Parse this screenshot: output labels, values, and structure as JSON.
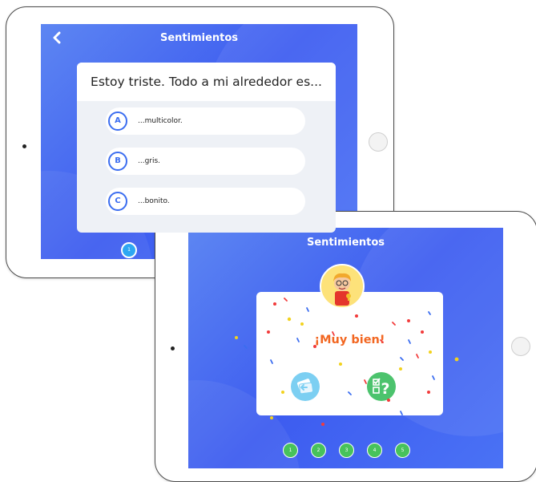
{
  "back_tablet": {
    "title": "Sentimientos",
    "back_icon": "chevron-left-icon",
    "question": "Estoy triste. Todo a mi alrededor es...",
    "options": [
      {
        "letter": "A",
        "text": "...multicolor."
      },
      {
        "letter": "B",
        "text": "...gris."
      },
      {
        "letter": "C",
        "text": "...bonito."
      }
    ],
    "progress_dot": "1"
  },
  "front_tablet": {
    "title": "Sentimientos",
    "feedback": "¡Muy bien!",
    "buttons": [
      {
        "icon": "review-cards-icon"
      },
      {
        "icon": "quiz-question-icon"
      }
    ],
    "progress": [
      "1",
      "2",
      "3",
      "4",
      "5"
    ]
  },
  "colors": {
    "screen_blue": "#4a72f5",
    "option_accent": "#3b6df0",
    "feedback_orange": "#f26722",
    "progress_green": "#47c25b",
    "current_dot": "#2ea7f2",
    "review_button": "#7ccff2",
    "quiz_button": "#4cc36d"
  }
}
